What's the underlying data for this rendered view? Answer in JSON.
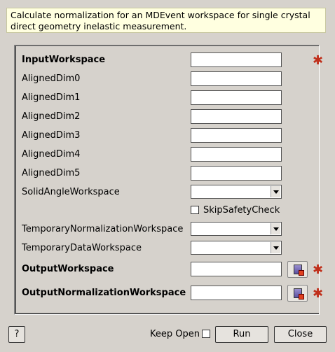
{
  "description": "Calculate normalization for an MDEvent workspace for single crystal direct geometry inelastic measurement.",
  "colors": {
    "required_star": "#c0301c",
    "description_bg": "#ffffe0"
  },
  "fields": {
    "input_workspace": {
      "label": "InputWorkspace",
      "value": ""
    },
    "aligned_dim0": {
      "label": "AlignedDim0",
      "value": ""
    },
    "aligned_dim1": {
      "label": "AlignedDim1",
      "value": ""
    },
    "aligned_dim2": {
      "label": "AlignedDim2",
      "value": ""
    },
    "aligned_dim3": {
      "label": "AlignedDim3",
      "value": ""
    },
    "aligned_dim4": {
      "label": "AlignedDim4",
      "value": ""
    },
    "aligned_dim5": {
      "label": "AlignedDim5",
      "value": ""
    },
    "solid_angle_workspace": {
      "label": "SolidAngleWorkspace",
      "value": ""
    },
    "skip_safety_check": {
      "label": "SkipSafetyCheck",
      "checked": false
    },
    "temporary_normalization_workspace": {
      "label": "TemporaryNormalizationWorkspace",
      "value": ""
    },
    "temporary_data_workspace": {
      "label": "TemporaryDataWorkspace",
      "value": ""
    },
    "output_workspace": {
      "label": "OutputWorkspace",
      "value": ""
    },
    "output_normalization_workspace": {
      "label": "OutputNormalizationWorkspace",
      "value": ""
    }
  },
  "required_marker": "*",
  "footer": {
    "help_label": "?",
    "keep_open_label": "Keep Open",
    "keep_open_checked": false,
    "run_label": "Run",
    "close_label": "Close"
  }
}
